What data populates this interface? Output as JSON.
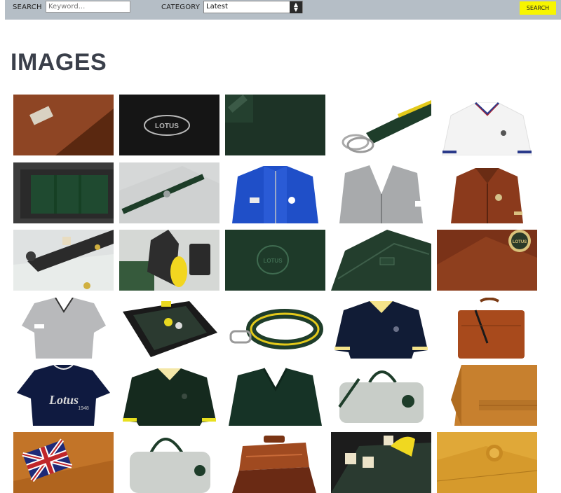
{
  "search": {
    "label": "SEARCH",
    "placeholder": "Keyword...",
    "button": "SEARCH"
  },
  "category": {
    "label": "CATEGORY",
    "selected": "Latest"
  },
  "page": {
    "title": "IMAGES"
  },
  "logo_text": [
    "LOTUS",
    "LOTUS",
    "LOTUS",
    "LOTUS"
  ],
  "shirt_text": {
    "lotus": "Lotus",
    "year": "1948"
  },
  "gallery": {
    "columns": 5,
    "items": [
      {
        "name": "leather-jacket-label"
      },
      {
        "name": "black-fabric-logo"
      },
      {
        "name": "green-fabric-tag"
      },
      {
        "name": "green-yellow-belt"
      },
      {
        "name": "white-polo"
      },
      {
        "name": "carbon-green-box"
      },
      {
        "name": "stitched-case"
      },
      {
        "name": "blue-track-jacket"
      },
      {
        "name": "grey-cardigan"
      },
      {
        "name": "brown-leather-jacket"
      },
      {
        "name": "backgammon-set"
      },
      {
        "name": "yellow-pouch-kit"
      },
      {
        "name": "green-logo-closeup"
      },
      {
        "name": "green-bag-detail"
      },
      {
        "name": "leather-jacket-badge"
      },
      {
        "name": "grey-women-polo"
      },
      {
        "name": "backgammon-board-open"
      },
      {
        "name": "green-yellow-belt-coiled"
      },
      {
        "name": "navy-polo"
      },
      {
        "name": "tan-briefcase"
      },
      {
        "name": "navy-lotus-tshirt"
      },
      {
        "name": "green-polo"
      },
      {
        "name": "green-vneck-sweater"
      },
      {
        "name": "grey-holdall"
      },
      {
        "name": "tan-jacket-back"
      },
      {
        "name": "union-jack-patch"
      },
      {
        "name": "grey-holdall-side"
      },
      {
        "name": "open-briefcase"
      },
      {
        "name": "dice-closeup"
      },
      {
        "name": "yellow-leather-closeup"
      }
    ]
  }
}
